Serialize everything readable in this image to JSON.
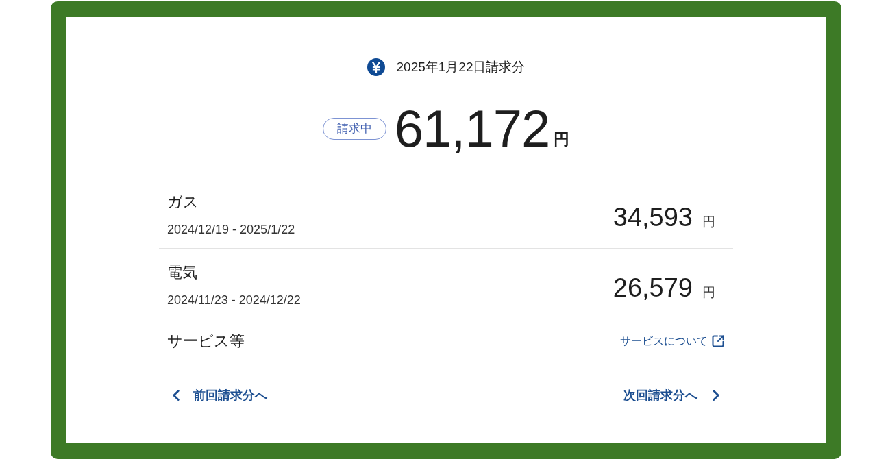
{
  "header": {
    "title": "2025年1月22日請求分"
  },
  "total": {
    "status": "請求中",
    "amount": "61,172",
    "unit": "円"
  },
  "items": [
    {
      "name": "ガス",
      "period": "2024/12/19 - 2025/1/22",
      "amount": "34,593",
      "unit": "円"
    },
    {
      "name": "電気",
      "period": "2024/11/23 - 2024/12/22",
      "amount": "26,579",
      "unit": "円"
    }
  ],
  "services": {
    "label": "サービス等",
    "link": "サービスについて"
  },
  "nav": {
    "previous": "前回請求分へ",
    "next": "次回請求分へ"
  }
}
